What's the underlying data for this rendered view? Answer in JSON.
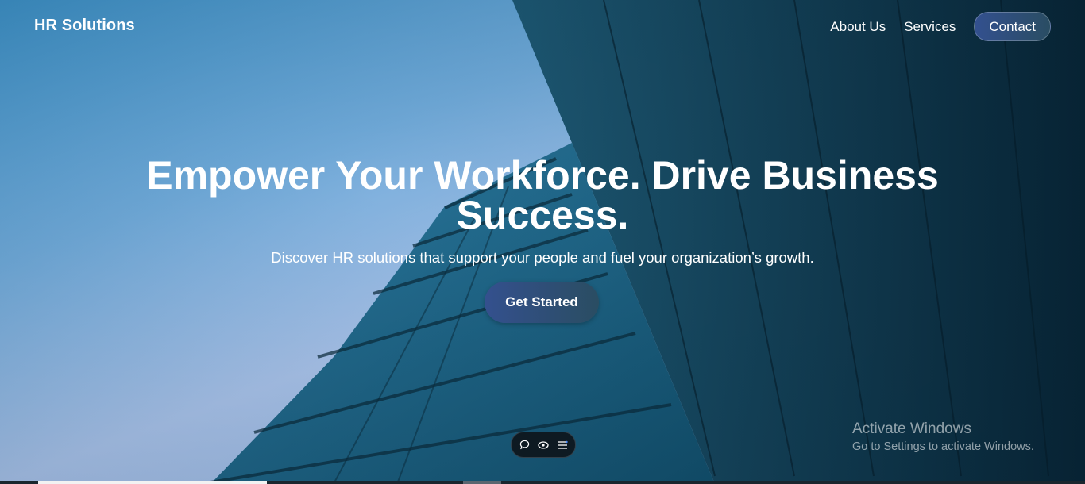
{
  "brand": "HR Solutions",
  "nav": {
    "about": "About Us",
    "services": "Services",
    "contact": "Contact"
  },
  "hero": {
    "headline_line1": "Empower Your Workforce. Drive Business",
    "headline_line2": "Success.",
    "subtitle": "Discover HR solutions that support your people and fuel your organization’s growth.",
    "cta": "Get Started"
  },
  "toolbar": {
    "icons": [
      "chat-icon",
      "eye-icon",
      "list-icon"
    ]
  },
  "watermark": {
    "title": "Activate Windows",
    "subtitle": "Go to Settings to activate Windows."
  },
  "colors": {
    "button_gradient_start": "#34508e",
    "button_gradient_end": "#2a4d62",
    "text": "#ffffff"
  }
}
